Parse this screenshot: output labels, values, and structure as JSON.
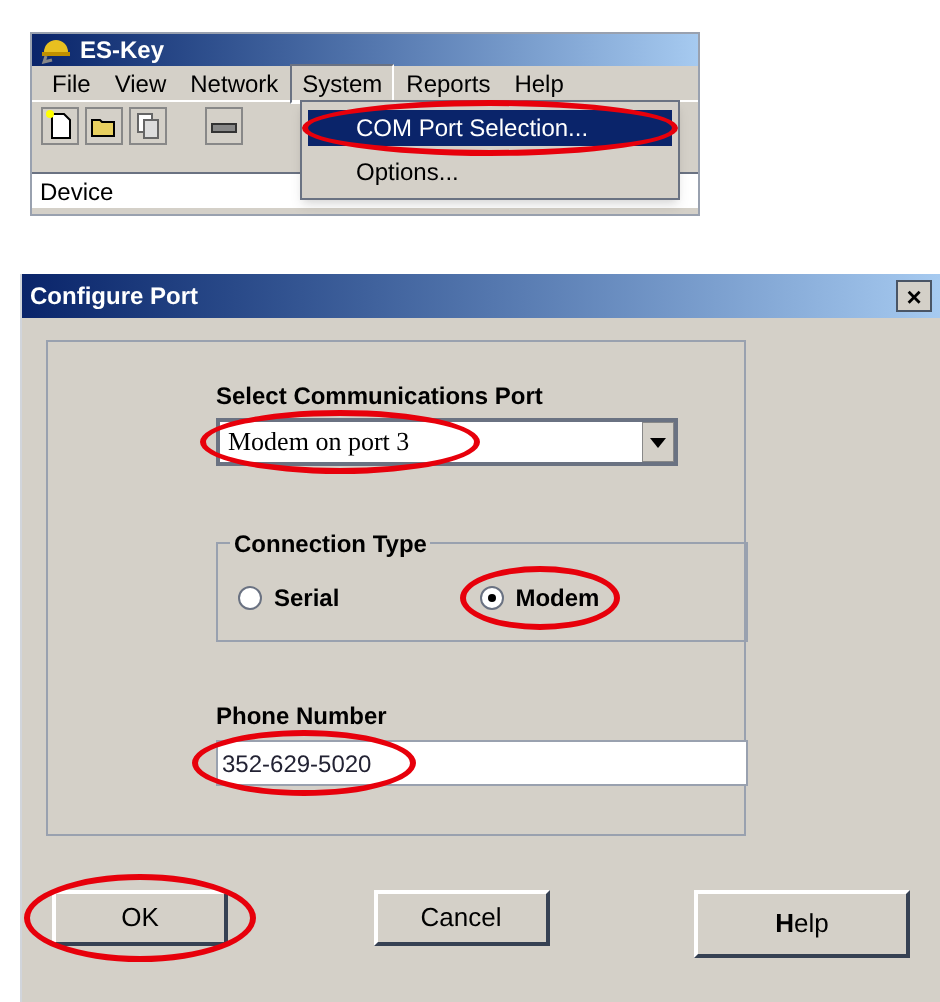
{
  "app_window": {
    "title": "ES-Key",
    "menu_bar": [
      {
        "label": "File",
        "selected": false
      },
      {
        "label": "View",
        "selected": false
      },
      {
        "label": "Network",
        "selected": false
      },
      {
        "label": "System",
        "selected": true
      },
      {
        "label": "Reports",
        "selected": false
      },
      {
        "label": "Help",
        "selected": false
      }
    ],
    "dropdown_menu": [
      {
        "label": "COM Port Selection...",
        "selected": true,
        "circled": true
      },
      {
        "label": "Options...",
        "selected": false,
        "circled": false
      }
    ],
    "columns": [
      "Device"
    ]
  },
  "dialog": {
    "title": "Configure Port",
    "close": "×",
    "port_label": "Select Communications Port",
    "port": {
      "value": "Modem on port 3",
      "circled": true
    },
    "connection_type": {
      "label": "Connection Type",
      "options": [
        {
          "label": "Serial",
          "selected": false,
          "circled": false
        },
        {
          "label": "Modem",
          "selected": true,
          "circled": true
        }
      ]
    },
    "phone_label": "Phone Number",
    "phone": {
      "value": "352-629-5020",
      "circled": true
    },
    "buttons": [
      {
        "label": "OK",
        "circled": true
      },
      {
        "label": "Cancel",
        "circled": false
      },
      {
        "label": "**H**elp",
        "circled": false
      }
    ]
  }
}
